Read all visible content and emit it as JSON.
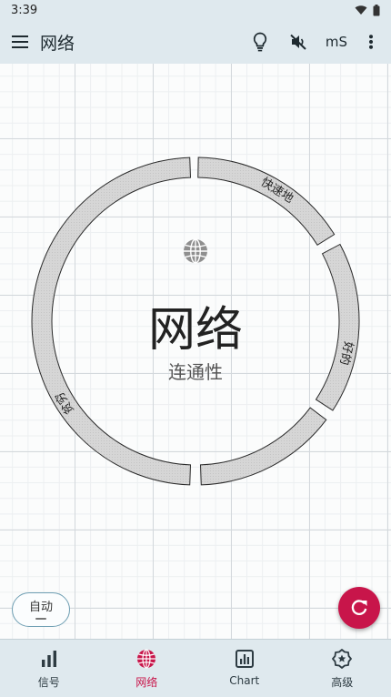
{
  "status_bar": {
    "time": "3:39"
  },
  "app_bar": {
    "title": "网络",
    "ms_label": "mS"
  },
  "gauge": {
    "title": "网络",
    "subtitle": "连通性",
    "segments": [
      "快速地",
      "好的",
      "",
      "贫穷"
    ]
  },
  "auto_chip": {
    "label": "自动"
  },
  "bottom_nav": {
    "items": [
      {
        "label": "信号",
        "icon": "bar-chart-icon"
      },
      {
        "label": "网络",
        "icon": "globe-icon",
        "active": true
      },
      {
        "label": "Chart",
        "icon": "chart-icon"
      },
      {
        "label": "高级",
        "icon": "settings-star-icon"
      }
    ]
  },
  "colors": {
    "accent": "#c8154a",
    "bar_bg": "#dfe9ee",
    "gauge_fill": "#d8d8d8"
  }
}
